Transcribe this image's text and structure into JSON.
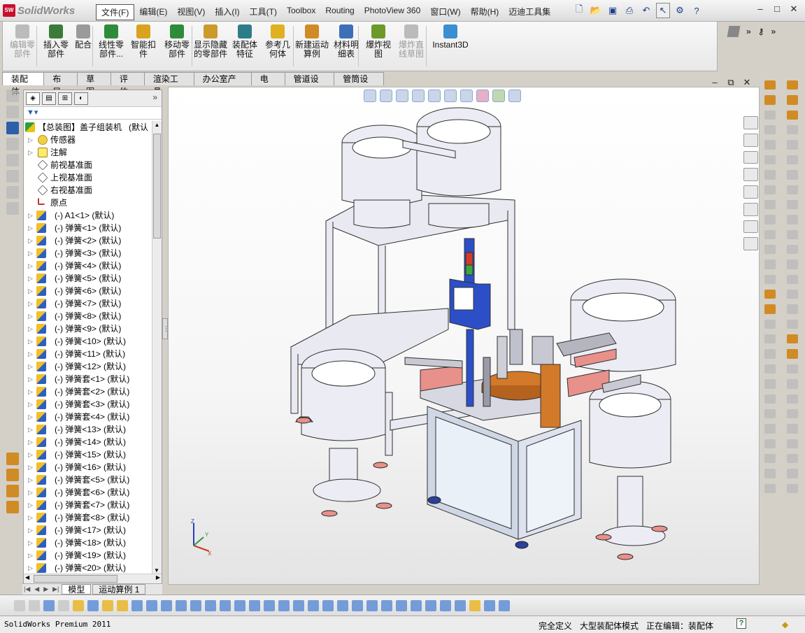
{
  "app": {
    "logo": "SolidWorks"
  },
  "menus": [
    "文件(F)",
    "编辑(E)",
    "视图(V)",
    "插入(I)",
    "工具(T)",
    "Toolbox",
    "Routing",
    "PhotoView 360",
    "窗口(W)",
    "帮助(H)",
    "迈迪工具集"
  ],
  "ribbon": {
    "items": [
      {
        "label": "编辑零部件",
        "disabled": true
      },
      {
        "label": "插入零部件",
        "disabled": false
      },
      {
        "label": "配合",
        "disabled": false
      },
      {
        "label": "线性零部件...",
        "disabled": false
      },
      {
        "label": "智能扣件",
        "disabled": false
      },
      {
        "label": "移动零部件",
        "disabled": false
      },
      {
        "label": "显示隐藏的零部件",
        "disabled": false
      },
      {
        "label": "装配体特征",
        "disabled": false
      },
      {
        "label": "参考几何体",
        "disabled": false
      },
      {
        "label": "新建运动算例",
        "disabled": false
      },
      {
        "label": "材料明细表",
        "disabled": false
      },
      {
        "label": "爆炸视图",
        "disabled": false
      },
      {
        "label": "爆炸直线草图",
        "disabled": true
      },
      {
        "label": "Instant3D",
        "disabled": false
      }
    ]
  },
  "tabs": [
    "装配体",
    "布局",
    "草图",
    "评估",
    "渲染工具",
    "办公室产品",
    "电气",
    "管道设计",
    "管筒设计"
  ],
  "tree": {
    "root": "【总装图】盖子组装机",
    "root_config": "(默认",
    "items": [
      {
        "type": "sensor",
        "label": "传感器"
      },
      {
        "type": "ann",
        "label": "注解"
      },
      {
        "type": "plane",
        "label": "前视基准面"
      },
      {
        "type": "plane",
        "label": "上视基准面"
      },
      {
        "type": "plane",
        "label": "右视基准面"
      },
      {
        "type": "origin",
        "label": "原点"
      },
      {
        "type": "part",
        "label": "(-) A1<1> (默认)"
      },
      {
        "type": "part",
        "label": "(-) 弹簧<1> (默认)"
      },
      {
        "type": "part",
        "label": "(-) 弹簧<2> (默认)"
      },
      {
        "type": "part",
        "label": "(-) 弹簧<3> (默认)"
      },
      {
        "type": "part",
        "label": "(-) 弹簧<4> (默认)"
      },
      {
        "type": "part",
        "label": "(-) 弹簧<5> (默认)"
      },
      {
        "type": "part",
        "label": "(-) 弹簧<6> (默认)"
      },
      {
        "type": "part",
        "label": "(-) 弹簧<7> (默认)"
      },
      {
        "type": "part",
        "label": "(-) 弹簧<8> (默认)"
      },
      {
        "type": "part",
        "label": "(-) 弹簧<9> (默认)"
      },
      {
        "type": "part",
        "label": "(-) 弹簧<10> (默认)"
      },
      {
        "type": "part",
        "label": "(-) 弹簧<11> (默认)"
      },
      {
        "type": "part",
        "label": "(-) 弹簧<12> (默认)"
      },
      {
        "type": "part",
        "label": "(-) 弹簧套<1> (默认)"
      },
      {
        "type": "part",
        "label": "(-) 弹簧套<2> (默认)"
      },
      {
        "type": "part",
        "label": "(-) 弹簧套<3> (默认)"
      },
      {
        "type": "part",
        "label": "(-) 弹簧套<4> (默认)"
      },
      {
        "type": "part",
        "label": "(-) 弹簧<13> (默认)"
      },
      {
        "type": "part",
        "label": "(-) 弹簧<14> (默认)"
      },
      {
        "type": "part",
        "label": "(-) 弹簧<15> (默认)"
      },
      {
        "type": "part",
        "label": "(-) 弹簧<16> (默认)"
      },
      {
        "type": "part",
        "label": "(-) 弹簧套<5> (默认)"
      },
      {
        "type": "part",
        "label": "(-) 弹簧套<6> (默认)"
      },
      {
        "type": "part",
        "label": "(-) 弹簧套<7> (默认)"
      },
      {
        "type": "part",
        "label": "(-) 弹簧套<8> (默认)"
      },
      {
        "type": "part",
        "label": "(-) 弹簧<17> (默认)"
      },
      {
        "type": "part",
        "label": "(-) 弹簧<18> (默认)"
      },
      {
        "type": "part",
        "label": "(-) 弹簧<19> (默认)"
      },
      {
        "type": "part",
        "label": "(-) 弹簧<20> (默认)"
      }
    ]
  },
  "bottom_tabs": [
    "模型",
    "运动算例 1"
  ],
  "status": {
    "product": "SolidWorks Premium 2011",
    "definition": "完全定义",
    "mode": "大型装配体模式",
    "editing": "正在编辑：装配体",
    "help": "?"
  },
  "colors": {
    "accent": "#2d5ea8",
    "frame": "#e6e6ee",
    "turntable": "#d27a2a",
    "panel": "#2c4fc8",
    "tray": "#e8908a"
  }
}
